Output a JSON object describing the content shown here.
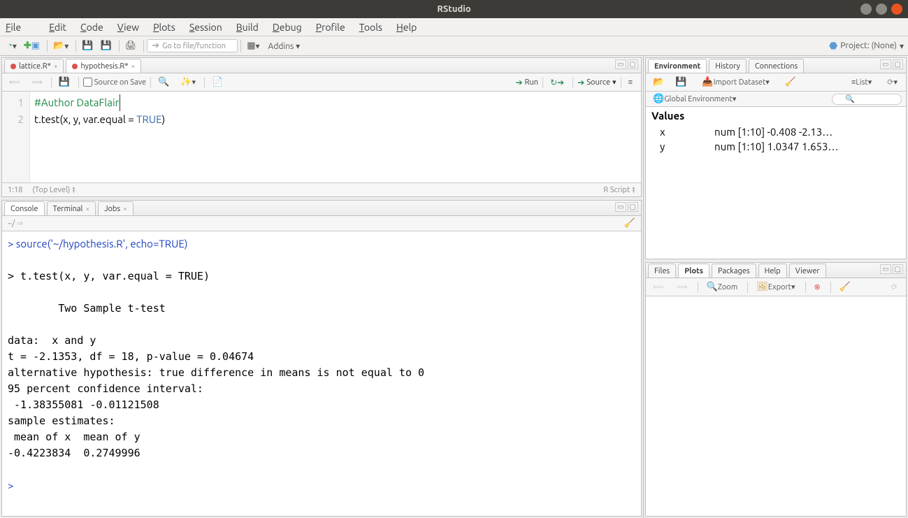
{
  "titlebar": {
    "title": "RStudio"
  },
  "menu": {
    "file": "File",
    "edit": "Edit",
    "code": "Code",
    "view": "View",
    "plots": "Plots",
    "session": "Session",
    "build": "Build",
    "debug": "Debug",
    "profile": "Profile",
    "tools": "Tools",
    "help": "Help"
  },
  "main_toolbar": {
    "goto_placeholder": "Go to file/function",
    "addins": "Addins",
    "project": "Project: (None)"
  },
  "source": {
    "tabs": [
      {
        "label": "lattice.R*",
        "modified": true
      },
      {
        "label": "hypothesis.R*",
        "modified": true
      }
    ],
    "source_on_save": "Source on Save",
    "run": "Run",
    "source_btn": "Source",
    "gutter": [
      "1",
      "2"
    ],
    "lines": {
      "l1": "#Author DataFlair",
      "l2a": "t.test(x, y, var.equal = ",
      "l2_true": "TRUE",
      "l2b": ")"
    },
    "status_pos": "1:18",
    "status_scope": "(Top Level)",
    "status_lang": "R Script"
  },
  "console": {
    "tabs": {
      "console": "Console",
      "terminal": "Terminal",
      "jobs": "Jobs"
    },
    "cwd": "~/",
    "body": "> source('~/hypothesis.R', echo=TRUE)\n\n> t.test(x, y, var.equal = TRUE)\n\n        Two Sample t-test\n\ndata:  x and y\nt = -2.1353, df = 18, p-value = 0.04674\nalternative hypothesis: true difference in means is not equal to 0\n95 percent confidence interval:\n -1.38355081 -0.01121508\nsample estimates:\n mean of x  mean of y \n-0.4223834  0.2749996 \n\n> ",
    "cmd_line": "> source('~/hypothesis.R', echo=TRUE)"
  },
  "env": {
    "tabs": {
      "env": "Environment",
      "history": "History",
      "conn": "Connections"
    },
    "import": "Import Dataset",
    "list_mode": "List",
    "scope": "Global Environment",
    "header": "Values",
    "rows": [
      {
        "name": "x",
        "value": "num [1:10] -0.408 -2.13…"
      },
      {
        "name": "y",
        "value": "num [1:10] 1.0347 1.653…"
      }
    ]
  },
  "plots": {
    "tabs": {
      "files": "Files",
      "plots": "Plots",
      "packages": "Packages",
      "help": "Help",
      "viewer": "Viewer"
    },
    "zoom": "Zoom",
    "export": "Export"
  }
}
